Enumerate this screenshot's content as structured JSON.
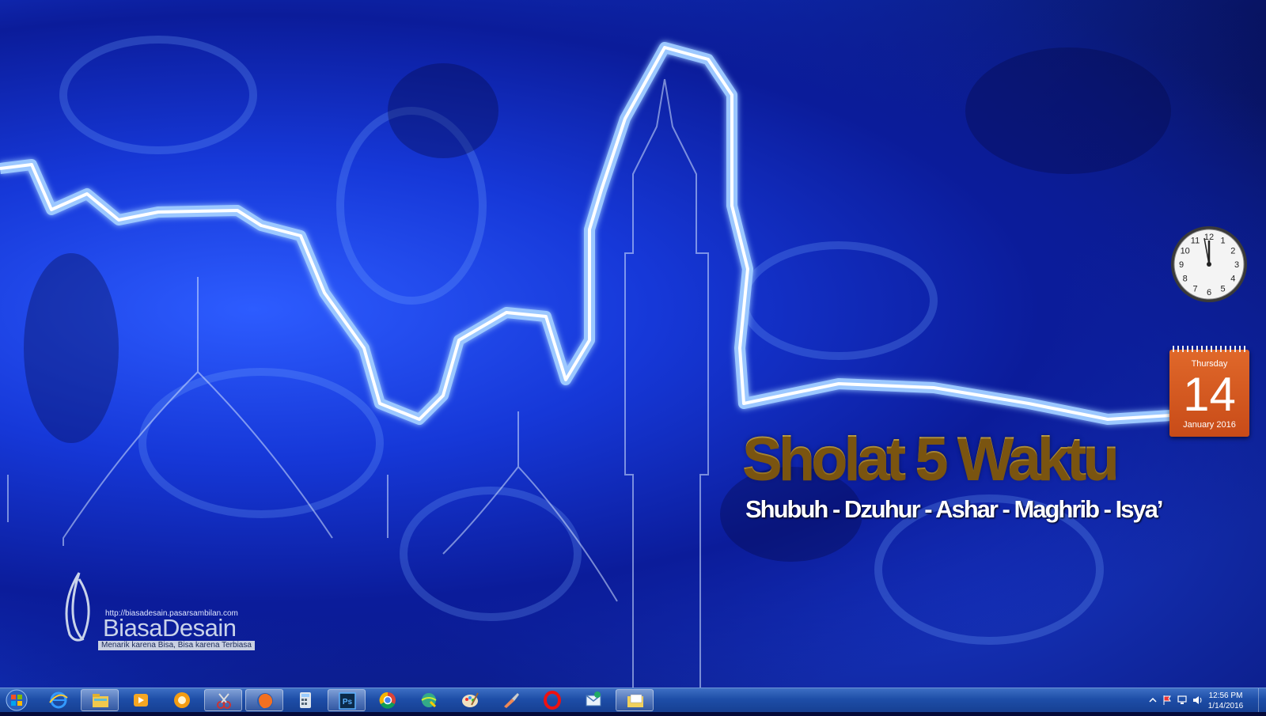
{
  "wallpaper": {
    "title": "Sholat 5 Waktu",
    "subtitle": "Shubuh - Dzuhur - Ashar - Maghrib - Isya’",
    "logo_url": "http://biasadesain.pasarsambilan.com",
    "logo_name": "BiasaDesain",
    "logo_tagline": "Menarik karena Bisa, Bisa karena Terbiasa"
  },
  "clock_gadget": {
    "numbers": [
      "12",
      "1",
      "2",
      "3",
      "4",
      "5",
      "6",
      "7",
      "8",
      "9",
      "10",
      "11"
    ],
    "time": "12:56"
  },
  "calendar_gadget": {
    "weekday": "Thursday",
    "day": "14",
    "month_year": "January 2016"
  },
  "taskbar": {
    "pinned": [
      {
        "name": "internet-explorer-icon",
        "active": false
      },
      {
        "name": "windows-explorer-icon",
        "active": true
      },
      {
        "name": "media-player-icon",
        "active": false
      },
      {
        "name": "media-center-icon",
        "active": false
      },
      {
        "name": "snipping-tool-icon",
        "active": true
      },
      {
        "name": "firefox-icon",
        "active": true
      },
      {
        "name": "calculator-icon",
        "active": false
      },
      {
        "name": "photoshop-icon",
        "active": true
      },
      {
        "name": "chrome-icon",
        "active": false
      },
      {
        "name": "globe-download-icon",
        "active": false
      },
      {
        "name": "paint-icon",
        "active": false
      },
      {
        "name": "tool-icon",
        "active": false
      },
      {
        "name": "opera-icon",
        "active": false
      },
      {
        "name": "mail-icon",
        "active": false
      },
      {
        "name": "folder-window-icon",
        "active": true
      }
    ],
    "tray": {
      "time": "12:56 PM",
      "date": "1/14/2016"
    },
    "colors": {
      "bar": "#1e4ea8",
      "accent": "#d9a833"
    }
  }
}
